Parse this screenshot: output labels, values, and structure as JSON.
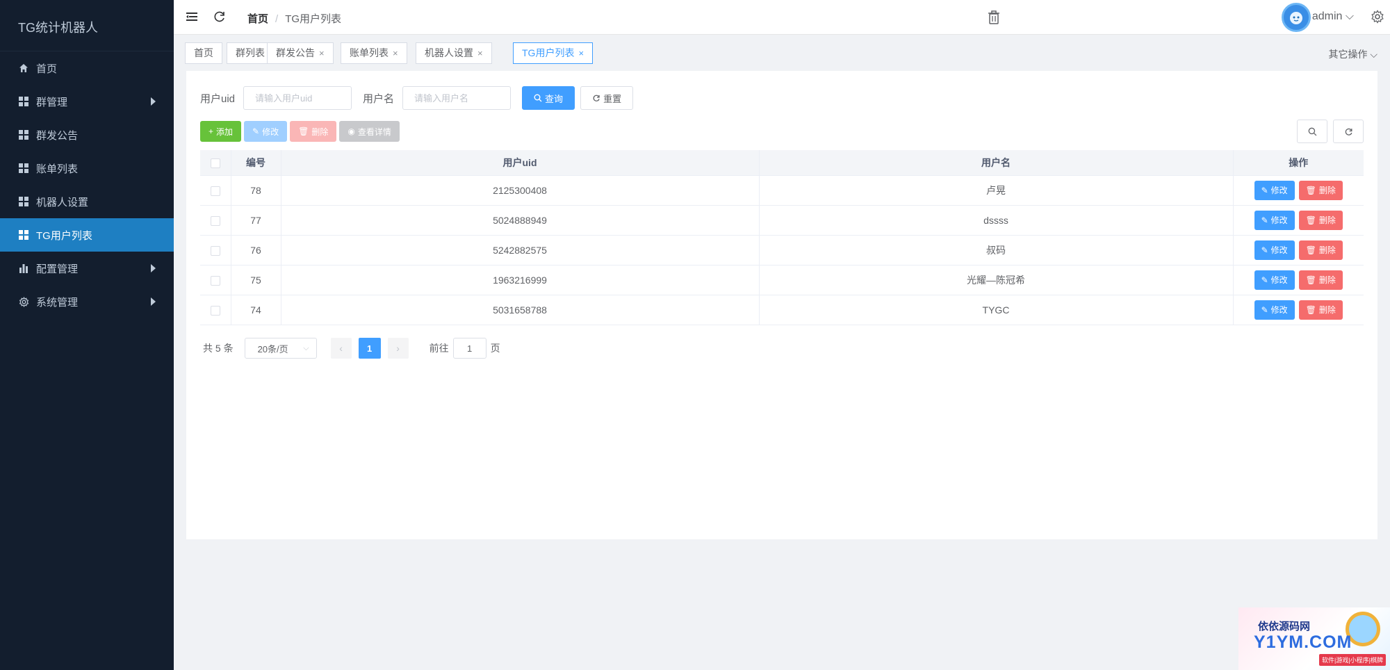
{
  "sidebar": {
    "logo": "TG统计机器人",
    "items": [
      {
        "label": "首页",
        "icon": "home-icon",
        "has_children": false,
        "active": false
      },
      {
        "label": "群管理",
        "icon": "grid-icon",
        "has_children": true,
        "active": false
      },
      {
        "label": "群发公告",
        "icon": "grid-icon",
        "has_children": false,
        "active": false
      },
      {
        "label": "账单列表",
        "icon": "grid-icon",
        "has_children": false,
        "active": false
      },
      {
        "label": "机器人设置",
        "icon": "grid-icon",
        "has_children": false,
        "active": false
      },
      {
        "label": "TG用户列表",
        "icon": "grid-icon",
        "has_children": false,
        "active": true
      },
      {
        "label": "配置管理",
        "icon": "bar-chart-icon",
        "has_children": true,
        "active": false
      },
      {
        "label": "系统管理",
        "icon": "gear-icon",
        "has_children": true,
        "active": false
      }
    ]
  },
  "header": {
    "breadcrumb_home": "首页",
    "breadcrumb_sep": "/",
    "breadcrumb_current": "TG用户列表",
    "user": "admin"
  },
  "tags": {
    "items": [
      {
        "label": "首页",
        "closable": false
      },
      {
        "label": "群列表",
        "closable": true
      },
      {
        "label": "群发公告",
        "closable": true
      },
      {
        "label": "账单列表",
        "closable": true
      },
      {
        "label": "机器人设置",
        "closable": true
      },
      {
        "label": "TG用户列表",
        "closable": true
      }
    ],
    "other_ops": "其它操作",
    "close_glyph": "×"
  },
  "search": {
    "uid_label": "用户uid",
    "uid_placeholder": "请输入用户uid",
    "name_label": "用户名",
    "name_placeholder": "请输入用户名",
    "query_label": "查询",
    "reset_label": "重置"
  },
  "toolbar": {
    "add_label": "添加",
    "edit_label": "修改",
    "delete_label": "删除",
    "view_label": "查看详情"
  },
  "table": {
    "columns": [
      "编号",
      "用户uid",
      "用户名",
      "操作"
    ],
    "rows": [
      {
        "id": "78",
        "uid": "2125300408",
        "name": "卢晃"
      },
      {
        "id": "77",
        "uid": "5024888949",
        "name": "dssss"
      },
      {
        "id": "76",
        "uid": "5242882575",
        "name": "叔码"
      },
      {
        "id": "75",
        "uid": "1963216999",
        "name": "光耀—陈冠希"
      },
      {
        "id": "74",
        "uid": "5031658788",
        "name": "TYGC"
      }
    ],
    "row_edit_label": "修改",
    "row_delete_label": "删除"
  },
  "pagination": {
    "total_text": "共 5 条",
    "page_size": "20条/页",
    "current_page": "1",
    "goto_label": "前往",
    "goto_value": "1",
    "page_unit": "页"
  },
  "watermark": {
    "title": "依依源码网",
    "brand": "Y1YM.COM",
    "sub": "软件|游戏|小程序|棋牌"
  },
  "colors": {
    "sidebar_bg": "#131e2e",
    "active_menu": "#1e7fc2",
    "primary": "#409eff",
    "success": "#67c23a",
    "danger": "#f56c6c"
  }
}
